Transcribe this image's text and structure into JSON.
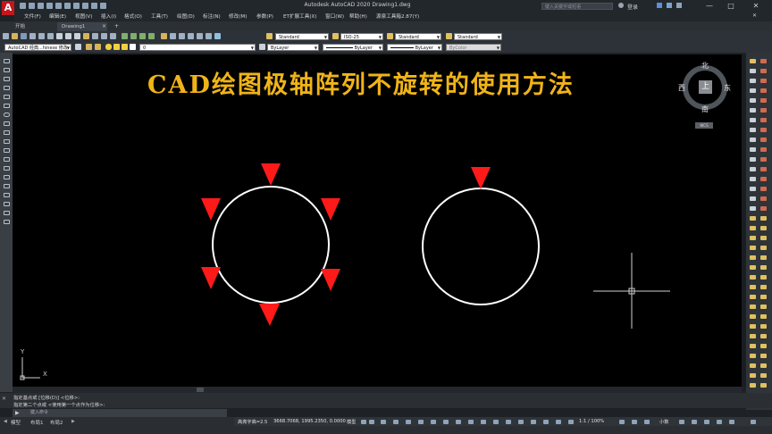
{
  "window": {
    "title": "Autodesk AutoCAD 2020    Drawing1.dwg",
    "search_placeholder": "键入关键字或短语",
    "login_label": "登录",
    "min": "—",
    "max": "□",
    "close": "✕"
  },
  "menu": [
    "文件(F)",
    "编辑(E)",
    "视图(V)",
    "插入(I)",
    "格式(O)",
    "工具(T)",
    "绘图(D)",
    "标注(N)",
    "修改(M)",
    "参数(P)",
    "ET扩展工具(X)",
    "窗口(W)",
    "帮助(H)",
    "源泉工具箱2.87(Y)"
  ],
  "tabs": {
    "start": "开始",
    "drawing": "Drawing1",
    "close": "×",
    "new": "+"
  },
  "toolbar": {
    "text_style": "Standard",
    "dim_style": "ISO-25",
    "table_style": "Standard",
    "multileader_style": "Standard",
    "workspace": "AutoCAD 经典...hinese 修改",
    "layer": "0",
    "color": "ByLayer",
    "linetype": "ByLayer",
    "lineweight": "ByLayer",
    "plot_style": "ByColor"
  },
  "canvas": {
    "heading": "CAD绘图极轴阵列不旋转的使用方法",
    "viewcube": {
      "north": "北",
      "south": "南",
      "east": "东",
      "west": "西",
      "top": "上",
      "wcs": "WCS"
    },
    "ucs": {
      "x": "X",
      "y": "Y"
    }
  },
  "command": {
    "history": [
      "指定基点或 [位移(D)] <位移>:",
      "指定第二个点或 <使用第一个点作为位移>:"
    ],
    "prompt": "键入命令"
  },
  "layouts": [
    "模型",
    "布局1",
    "布局2"
  ],
  "status": {
    "font_scale": "高亮字高=2.5",
    "coords": "3668.7068, 1995.2350, 0.0000",
    "model": "模型",
    "annotation_scale": "1:1 / 100%",
    "units": "小数"
  },
  "colors": {
    "background": "#000000",
    "heading": "#f0b418",
    "marker": "#ff1a1a",
    "circle": "#ffffff"
  }
}
